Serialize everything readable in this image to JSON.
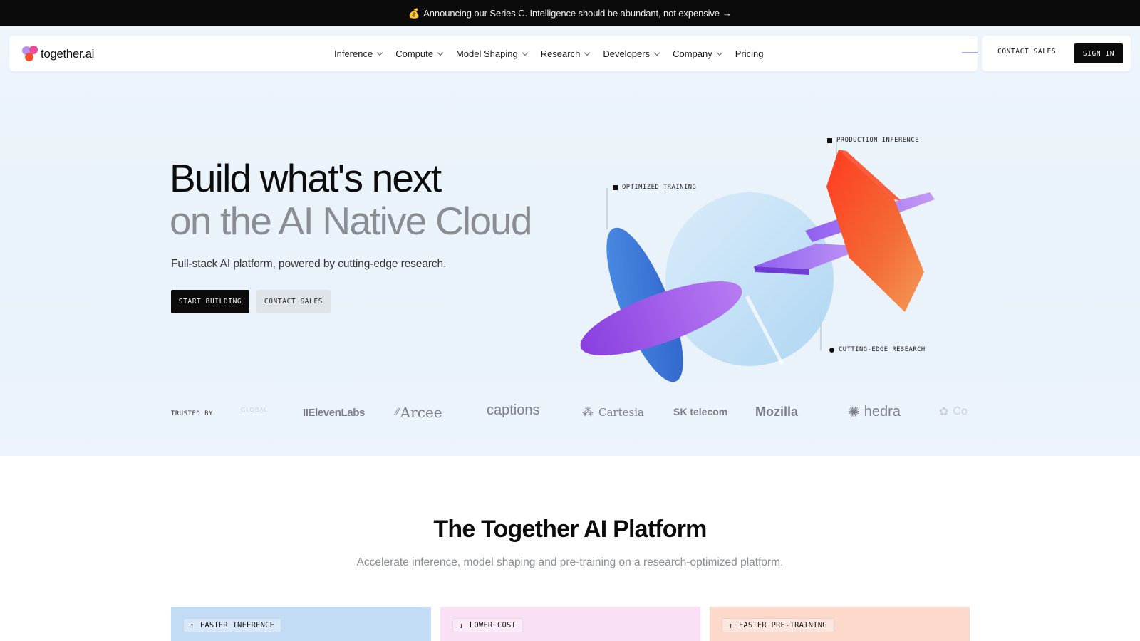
{
  "announcement": {
    "emoji": "💰",
    "text": "Announcing our Series C. Intelligence should be abundant, not expensive",
    "arrow": "→"
  },
  "nav": {
    "logo_text": "together.ai",
    "items": [
      {
        "label": "Inference",
        "has_dropdown": true
      },
      {
        "label": "Compute",
        "has_dropdown": true
      },
      {
        "label": "Model Shaping",
        "has_dropdown": true
      },
      {
        "label": "Research",
        "has_dropdown": true
      },
      {
        "label": "Developers",
        "has_dropdown": true
      },
      {
        "label": "Company",
        "has_dropdown": true
      },
      {
        "label": "Pricing",
        "has_dropdown": false
      }
    ],
    "contact_sales": "CONTACT SALES",
    "sign_in": "SIGN IN"
  },
  "hero": {
    "title_line1": "Build what's next",
    "title_line2": "on the AI Native Cloud",
    "subtitle": "Full-stack AI platform, powered by cutting-edge research.",
    "primary_cta": "START BUILDING",
    "secondary_cta": "CONTACT SALES",
    "art_labels": {
      "production": "PRODUCTION INFERENCE",
      "training": "OPTIMIZED TRAINING",
      "research": "CUTTING-EDGE RESEARCH"
    }
  },
  "trusted": {
    "label": "TRUSTED BY",
    "logos": [
      {
        "name": "GLOBAL"
      },
      {
        "name": "IIElevenLabs"
      },
      {
        "name": "Arcee"
      },
      {
        "name": "captions"
      },
      {
        "name": "Cartesia"
      },
      {
        "name": "SK telecom"
      },
      {
        "name": "Mozilla"
      },
      {
        "name": "hedra"
      },
      {
        "name": "Co"
      }
    ]
  },
  "platform": {
    "title": "The Together AI Platform",
    "subtitle": "Accelerate inference, model shaping and pre-training on a research-optimized platform.",
    "cards": [
      {
        "label": "FASTER INFERENCE",
        "arrow": "↑",
        "color": "#c3dcf5"
      },
      {
        "label": "LOWER COST",
        "arrow": "↓",
        "color": "#f9e0f4"
      },
      {
        "label": "FASTER PRE-TRAINING",
        "arrow": "↑",
        "color": "#fcd9cb"
      }
    ]
  },
  "colors": {
    "accent_dark": "#0b0b0b",
    "logo_pink": "#e94d9a",
    "logo_orange": "#f4502b",
    "logo_purple": "#b88ef0"
  }
}
